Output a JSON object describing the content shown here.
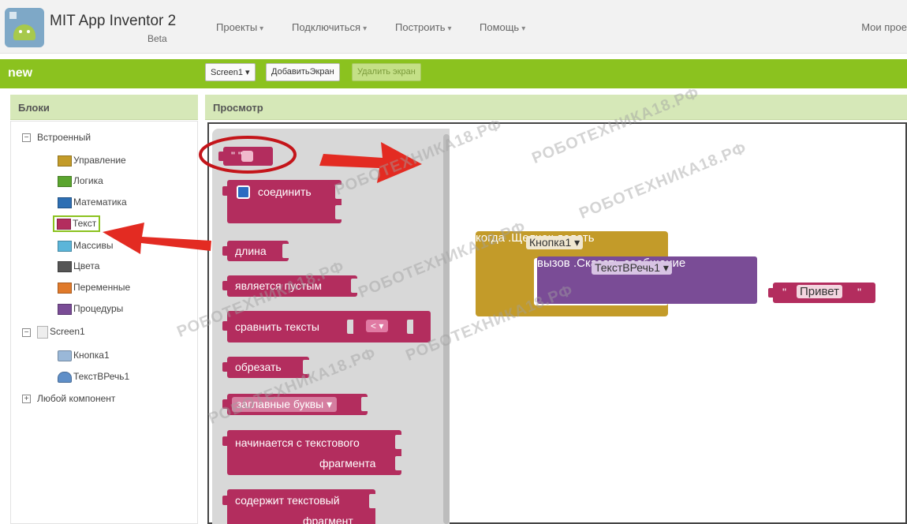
{
  "app": {
    "title": "MIT App Inventor 2",
    "subtitle": "Beta"
  },
  "menu": [
    {
      "label": "Проекты"
    },
    {
      "label": "Подключиться"
    },
    {
      "label": "Построить"
    },
    {
      "label": "Помощь"
    }
  ],
  "right_link": "Мои прое",
  "project": {
    "name": "new"
  },
  "screen_bar": {
    "screen_select": "Screen1",
    "add_screen": "ДобавитьЭкран",
    "remove_screen": "Удалить экран"
  },
  "panels": {
    "blocks_title": "Блоки",
    "viewer_title": "Просмотр"
  },
  "tree": {
    "builtin": "Встроенный",
    "builtin_items": [
      {
        "label": "Управление",
        "color": "#c39b29"
      },
      {
        "label": "Логика",
        "color": "#5ba52f"
      },
      {
        "label": "Математика",
        "color": "#2e6fb3"
      },
      {
        "label": "Текст",
        "color": "#b32d5e"
      },
      {
        "label": "Массивы",
        "color": "#5bb5d9"
      },
      {
        "label": "Цвета",
        "color": "#555555"
      },
      {
        "label": "Переменные",
        "color": "#e07a2b"
      },
      {
        "label": "Процедуры",
        "color": "#7a4c96"
      }
    ],
    "screen": "Screen1",
    "components": [
      {
        "label": "Кнопка1"
      },
      {
        "label": "ТекстВРечь1"
      }
    ],
    "any_component": "Любой компонент"
  },
  "flyout_blocks": {
    "string_literal": "\" \"",
    "join": "соединить",
    "length": "длина",
    "is_empty": "является пустым",
    "compare": "сравнить тексты",
    "compare_op": "<",
    "trim": "обрезать",
    "upcase": "заглавные буквы",
    "starts_with_1": "начинается с текстового",
    "starts_with_2": "фрагмента",
    "contains_1": "содержит текстовый",
    "contains_2": "фрагмент"
  },
  "workspace": {
    "when": "когда",
    "button": "Кнопка1",
    "click": ".Щелчок",
    "do": "делать",
    "call": "вызов",
    "tts": "ТекстВРечь1",
    "speak": ".Сказать",
    "message": "сообщение",
    "hello": "Привет",
    "quote": "\""
  },
  "watermark": "РОБОТЕХНИКА18.РФ",
  "colors": {
    "green": "#8bc21f",
    "text_block": "#b32d5e",
    "control": "#c39b29",
    "procedure": "#7a4c96",
    "annotation": "#e32b22"
  }
}
